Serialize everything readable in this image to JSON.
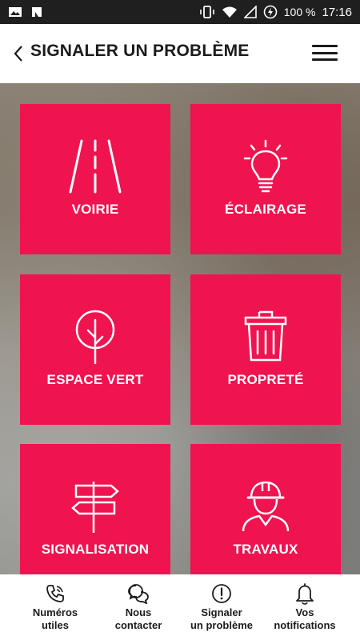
{
  "status_bar": {
    "battery": "100 %",
    "time": "17:16"
  },
  "header": {
    "title": "SIGNALER UN PROBLÈME"
  },
  "tiles": [
    {
      "label": "VOIRIE",
      "icon": "road-icon"
    },
    {
      "label": "ÉCLAIRAGE",
      "icon": "lightbulb-icon"
    },
    {
      "label": "ESPACE VERT",
      "icon": "tree-icon"
    },
    {
      "label": "PROPRETÉ",
      "icon": "trash-icon"
    },
    {
      "label": "SIGNALISATION",
      "icon": "signpost-icon"
    },
    {
      "label": "TRAVAUX",
      "icon": "worker-helmet-icon"
    }
  ],
  "bottom_nav": [
    {
      "label": "Numéros\nutiles",
      "icon": "phone-icon"
    },
    {
      "label": "Nous\ncontacter",
      "icon": "chat-bubbles-icon"
    },
    {
      "label": "Signaler\nun problème",
      "icon": "alert-circle-icon"
    },
    {
      "label": "Vos\nnotifications",
      "icon": "bell-icon"
    }
  ],
  "colors": {
    "tile": "#ef134f",
    "header_text": "#1b1b1b",
    "status_bar": "#1f1f1f"
  }
}
